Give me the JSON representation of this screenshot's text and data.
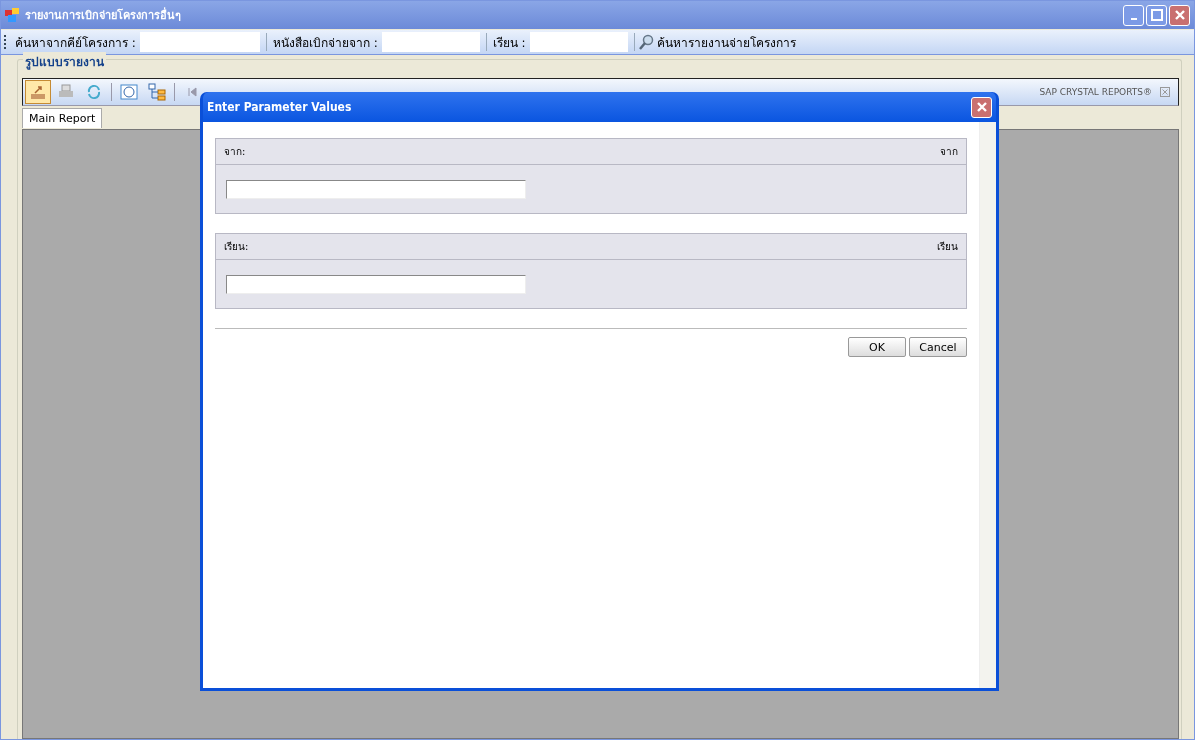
{
  "window": {
    "title": "รายงานการเบิกจ่ายโครงการอื่นๆ"
  },
  "toolbar": {
    "fields": [
      {
        "label": "ค้นหาจากคีย์โครงการ :"
      },
      {
        "label": "หนังสือเบิกจ่ายจาก :"
      },
      {
        "label": "เรียน :"
      }
    ],
    "search_button": "ค้นหารายงานจ่ายโครงการ"
  },
  "group": {
    "title": "รูปแบบรายงาน"
  },
  "viewer": {
    "brand": "SAP CRYSTAL REPORTS®",
    "tabs": [
      {
        "label": "Main Report",
        "selected": true
      }
    ]
  },
  "dialog": {
    "title": "Enter Parameter Values",
    "parameters": [
      {
        "label": "จาก:",
        "description": "จาก"
      },
      {
        "label": "เรียน:",
        "description": "เรียน"
      }
    ],
    "buttons": [
      "OK",
      "Cancel"
    ]
  }
}
